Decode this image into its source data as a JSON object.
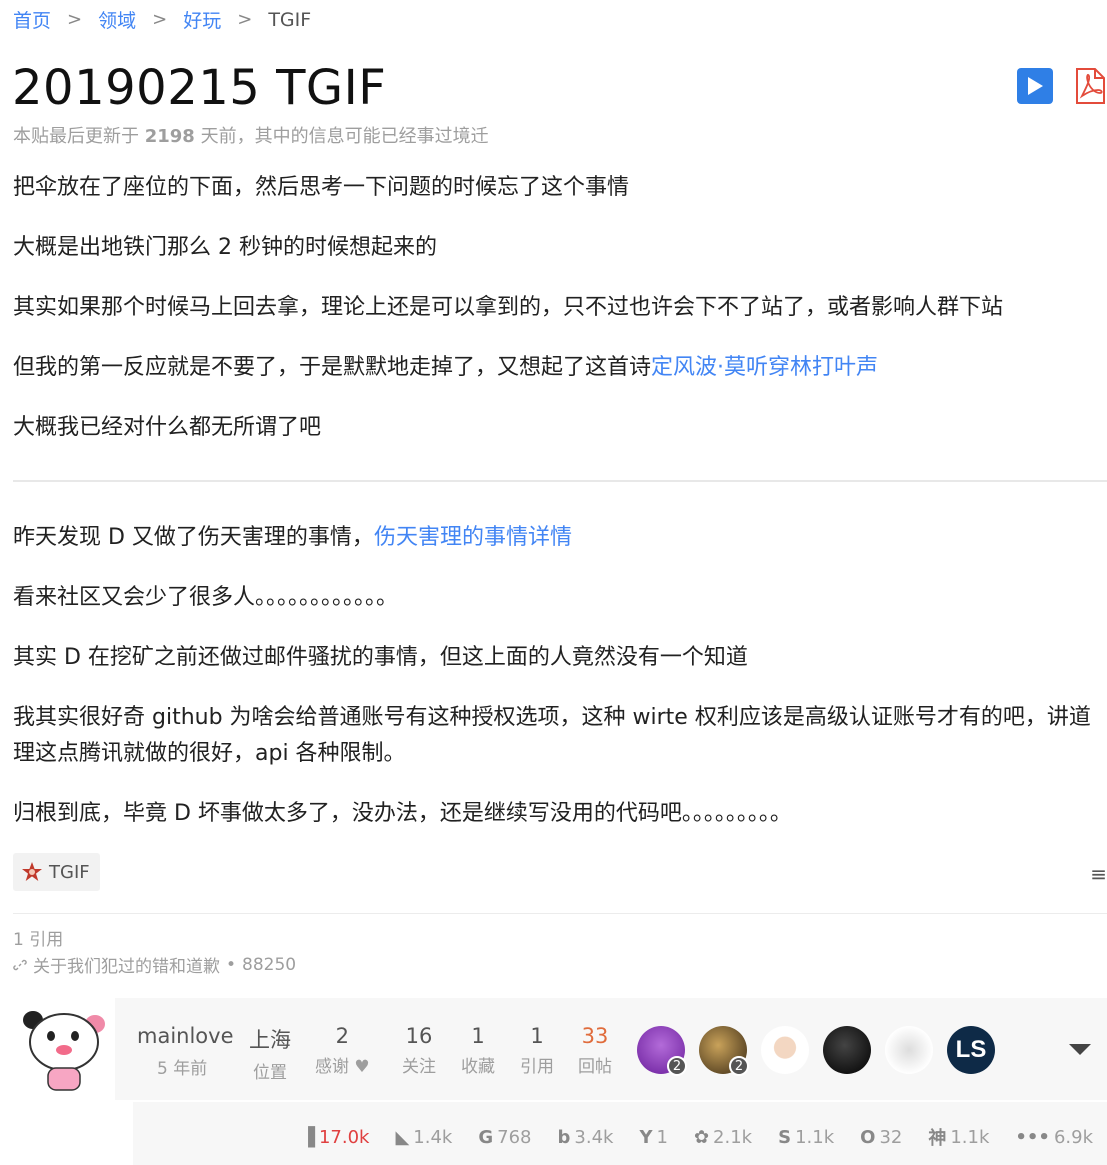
{
  "breadcrumb": {
    "items": [
      "首页",
      "领域",
      "好玩"
    ],
    "separator": ">",
    "current": "TGIF"
  },
  "post": {
    "title": "20190215 TGIF",
    "meta_prefix": "本贴最后更新于",
    "meta_days": "2198",
    "meta_suffix": "天前，其中的信息可能已经事过境迁"
  },
  "content": {
    "p1": "把伞放在了座位的下面，然后思考一下问题的时候忘了这个事情",
    "p2": "大概是出地铁门那么 2 秒钟的时候想起来的",
    "p3": "其实如果那个时候马上回去拿，理论上还是可以拿到的，只不过也许会下不了站了，或者影响人群下站",
    "p4_text": "但我的第一反应就是不要了，于是默默地走掉了，又想起了这首诗",
    "p4_link": "定风波·莫听穿林打叶声",
    "p5": "大概我已经对什么都无所谓了吧",
    "p6_text": "昨天发现 D 又做了伤天害理的事情，",
    "p6_link": "伤天害理的事情详情",
    "p7": "看来社区又会少了很多人。。。。。。。。。。。。",
    "p8": "其实 D 在挖矿之前还做过邮件骚扰的事情，但这上面的人竟然没有一个知道",
    "p9": "我其实很好奇 github 为啥会给普通账号有这种授权选项，这种 wirte 权利应该是高级认证账号才有的吧，讲道理这点腾讯就做的很好，api 各种限制。",
    "p10": "归根到底，毕竟 D 坏事做太多了，没办法，还是继续写没用的代码吧。。。。。。。。。"
  },
  "tag": {
    "label": "TGIF"
  },
  "menu_icon": "≡",
  "citations": {
    "count_label": "1 引用",
    "item_title": "关于我们犯过的错和道歉",
    "item_dot": "•",
    "item_views": "88250"
  },
  "author": {
    "name": "mainlove",
    "joined": "5 年前",
    "location": "上海",
    "location_label": "位置",
    "thanks": "2",
    "thanks_label": "感谢",
    "follow": "16",
    "follow_label": "关注",
    "collect": "1",
    "collect_label": "收藏",
    "cite": "1",
    "cite_label": "引用",
    "replies": "33",
    "replies_label": "回帖",
    "avatar_badges": [
      "2",
      "2"
    ]
  },
  "share": {
    "items": [
      {
        "icon": "bar-chart-icon",
        "glyph": "▐",
        "value": "17.0k",
        "hot": true
      },
      {
        "icon": "huawei-icon",
        "glyph": "◣",
        "value": "1.4k"
      },
      {
        "icon": "google-icon",
        "glyph": "G",
        "value": "768"
      },
      {
        "icon": "bing-icon",
        "glyph": "b",
        "value": "3.4k"
      },
      {
        "icon": "yandex-icon",
        "glyph": "Y",
        "value": "1"
      },
      {
        "icon": "baidu-icon",
        "glyph": "✿",
        "value": "2.1k"
      },
      {
        "icon": "sogou-icon",
        "glyph": "S",
        "value": "1.1k"
      },
      {
        "icon": "360-icon",
        "glyph": "O",
        "value": "32"
      },
      {
        "icon": "shenma-icon",
        "glyph": "神",
        "value": "1.1k"
      },
      {
        "icon": "more-icon",
        "glyph": "•••",
        "value": "6.9k"
      }
    ]
  },
  "colors": {
    "link": "#4285f4",
    "hot": "#e06c3c",
    "play_button": "#2f7fe6",
    "pdf": "#e34b3b"
  }
}
